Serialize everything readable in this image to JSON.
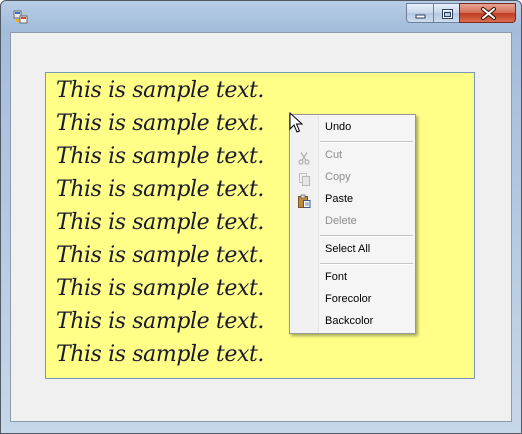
{
  "window": {
    "title": "",
    "buttons": [
      "minimize",
      "maximize",
      "close"
    ]
  },
  "textbox": {
    "background": "#ffff88",
    "lines": [
      "This is sample text.",
      "This is sample text.",
      "This is sample text.",
      "This is sample text.",
      "This is sample text.",
      "This is sample text.",
      "This is sample text.",
      "This is sample text.",
      "This is sample text."
    ]
  },
  "context_menu": {
    "items": [
      {
        "label": "Undo",
        "enabled": true
      },
      {
        "label": "Cut",
        "enabled": false,
        "icon": "scissors-icon"
      },
      {
        "label": "Copy",
        "enabled": false,
        "icon": "copy-icon"
      },
      {
        "label": "Paste",
        "enabled": true,
        "icon": "paste-icon"
      },
      {
        "label": "Delete",
        "enabled": false
      },
      {
        "label": "Select All",
        "enabled": true
      },
      {
        "label": "Font",
        "enabled": true
      },
      {
        "label": "Forecolor",
        "enabled": true
      },
      {
        "label": "Backcolor",
        "enabled": true
      }
    ]
  }
}
